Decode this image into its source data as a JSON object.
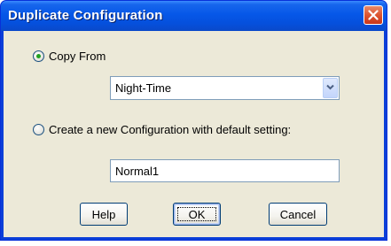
{
  "window": {
    "title": "Duplicate Configuration",
    "close_label": "Close"
  },
  "copy_from": {
    "label": "Copy From",
    "selected": true,
    "dropdown_value": "Night-Time"
  },
  "create_new": {
    "label": "Create a new Configuration with default setting:",
    "selected": false,
    "name_value": "Normal1"
  },
  "buttons": {
    "help": "Help",
    "ok": "OK",
    "cancel": "Cancel"
  },
  "colors": {
    "titlebar": "#0657e8",
    "client_bg": "#ece9d8",
    "radio_dot": "#21a121",
    "close_btn": "#dd5531"
  }
}
